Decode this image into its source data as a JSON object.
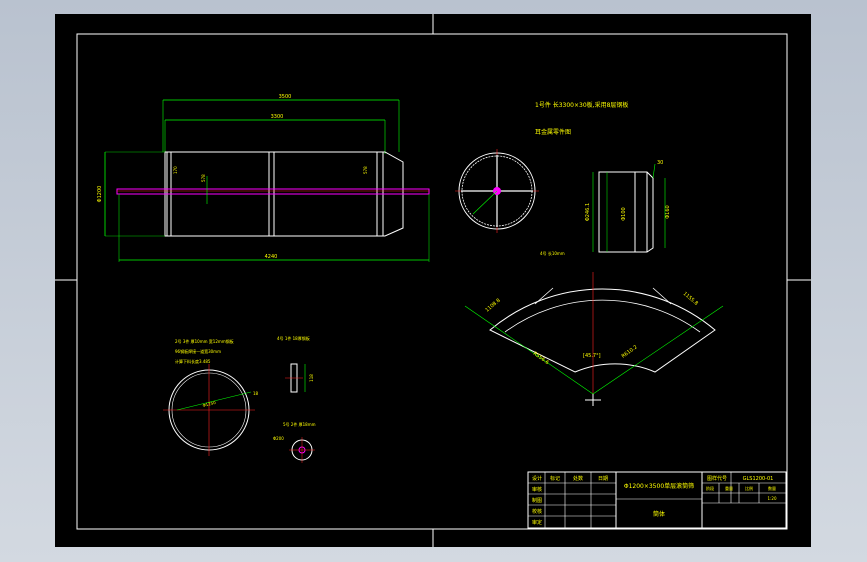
{
  "notes": {
    "part1_line1": "1号件 长3300×30板,采用8层钢板",
    "part1_line2": "耳金属零件图",
    "part2_dims": "4号 长10mm",
    "part3_line1": "2号 3件 厚10mm 宽12mm钢板",
    "part3_line2": "96钢板焊接一道宽30mm",
    "part3_line3": "计算下料长度3.485",
    "part4_line1": "4号 1件 18厚钢板",
    "part5_line1": "5号 2件 厚18mm"
  },
  "dims": {
    "overall_length": "3500",
    "inner_length": "3300",
    "bottom_length": "4240",
    "diameter": "Φ1200",
    "seg_170": "170",
    "seg_578": "578",
    "seg_578b": "578",
    "seg_118": "118",
    "seg_120": "120",
    "flange_d1": "Φ246.1",
    "flange_d2": "Φ100",
    "flange_d3": "Φ160",
    "flange_top": "30",
    "arc_left": "1108.8",
    "arc_right": "1155.8",
    "arc_r1": "R556.6",
    "arc_r2": "R610.2",
    "arc_angle": "[45.7°]",
    "circle_d": "Φ1250",
    "circle_side": "18",
    "small_d": "Φ200",
    "small_h": "118"
  },
  "title_block": {
    "row_labels": [
      "设计",
      "审核",
      "制图",
      "校核",
      "审定"
    ],
    "col_headers": [
      "标记",
      "处数",
      "分区",
      "日期"
    ],
    "title": "Φ1200×3500单层滚筒筛",
    "drawing_no_label": "图样代号",
    "drawing_no": "GLS1200-01",
    "sub_headers": [
      "阶段",
      "重量",
      "比例",
      "数量"
    ],
    "scale": "1:20",
    "part_name": "筒体"
  },
  "colors": {
    "lines": "#ffffff",
    "dims": "#00ff00",
    "center": "#ff2020",
    "text": "#ffff00",
    "shaft": "#ff00ff"
  }
}
